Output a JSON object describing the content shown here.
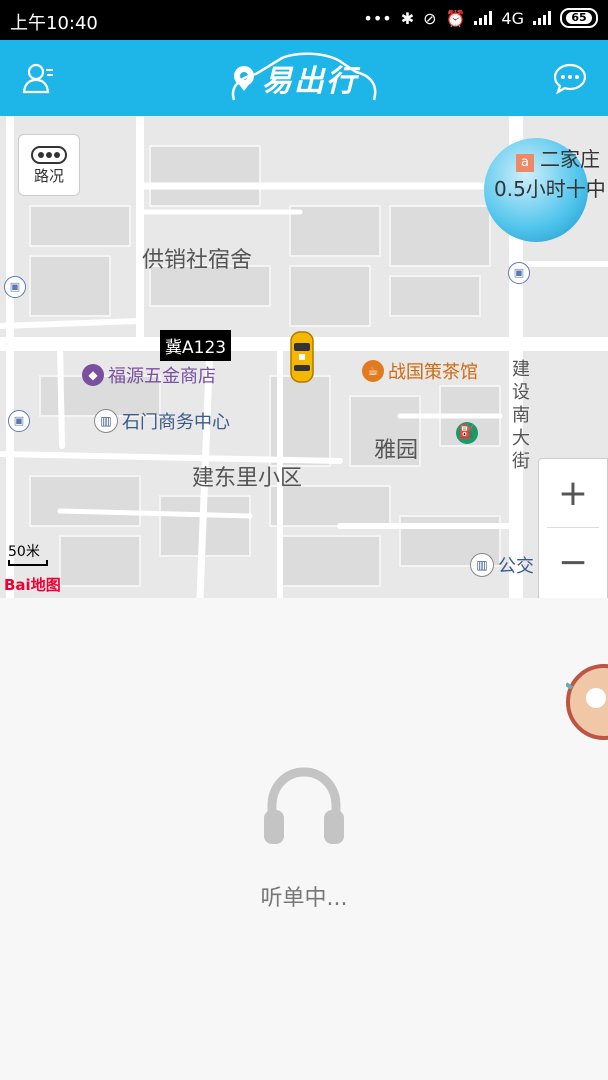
{
  "status_bar": {
    "time": "上午10:40",
    "dots": "•••",
    "network": "4G",
    "battery": "65"
  },
  "header": {
    "title": "易出行",
    "profile_icon": "user-profile-icon",
    "message_icon": "chat-bubble-icon"
  },
  "map": {
    "traffic_label": "路况",
    "scale_label": "50米",
    "provider_logo": "Bai地图",
    "car_plate": "冀A123",
    "float_badge": {
      "line1": "二家庄",
      "line2": "0.5小时十中"
    },
    "area_labels": {
      "gongxiao": "供销社宿舍",
      "yayuan": "雅园",
      "jiandongli": "建东里小区"
    },
    "street_label": "建设南大街",
    "pois": {
      "hardware_store": "福源五金商店",
      "business_center": "石门商务中心",
      "teahouse": "战国策茶馆",
      "bus": "公交"
    },
    "zoom_in": "+",
    "zoom_out": "−"
  },
  "bottom": {
    "listening_text": "听单中..."
  },
  "colors": {
    "brand_blue": "#1eb6e8",
    "tea_orange": "#e07b20",
    "store_purple": "#7a4fa0"
  }
}
